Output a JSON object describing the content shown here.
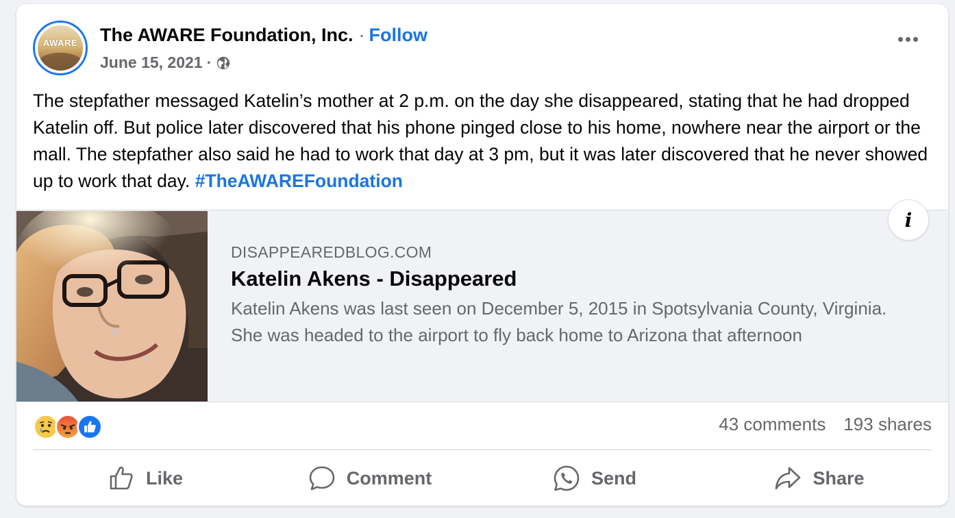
{
  "post": {
    "page_name": "The AWARE Foundation, Inc.",
    "separator": "·",
    "follow_label": "Follow",
    "date": "June 15, 2021",
    "meta_separator": "·",
    "audience_icon": "globe-icon",
    "avatar_text": "AWARE",
    "body": "The stepfather messaged Katelin’s mother at 2 p.m. on the day she disappeared, stating that he had dropped Katelin off. But police later discovered that his phone pinged close to his home, nowhere near the airport or the mall. The stepfather also said he had to work that day at 3 pm, but it was later discovered that he never showed up to work that day.",
    "hashtag": "#TheAWAREFoundation"
  },
  "link_preview": {
    "domain": "DISAPPEAREDBLOG.COM",
    "title": "Katelin Akens - Disappeared",
    "description": "Katelin Akens was last seen on December 5, 2015 in Spotsylvania County, Virginia. She was headed to the airport to fly back home to Arizona that afternoon",
    "info_label": "i"
  },
  "reactions": {
    "icons": [
      "sad-reaction-icon",
      "angry-reaction-icon",
      "like-reaction-icon"
    ],
    "comments": "43 comments",
    "shares": "193 shares"
  },
  "actions": {
    "like": "Like",
    "comment": "Comment",
    "send": "Send",
    "share": "Share"
  },
  "colors": {
    "accent": "#1b74e4",
    "secondary_text": "#65676b",
    "background": "#f0f2f5"
  }
}
